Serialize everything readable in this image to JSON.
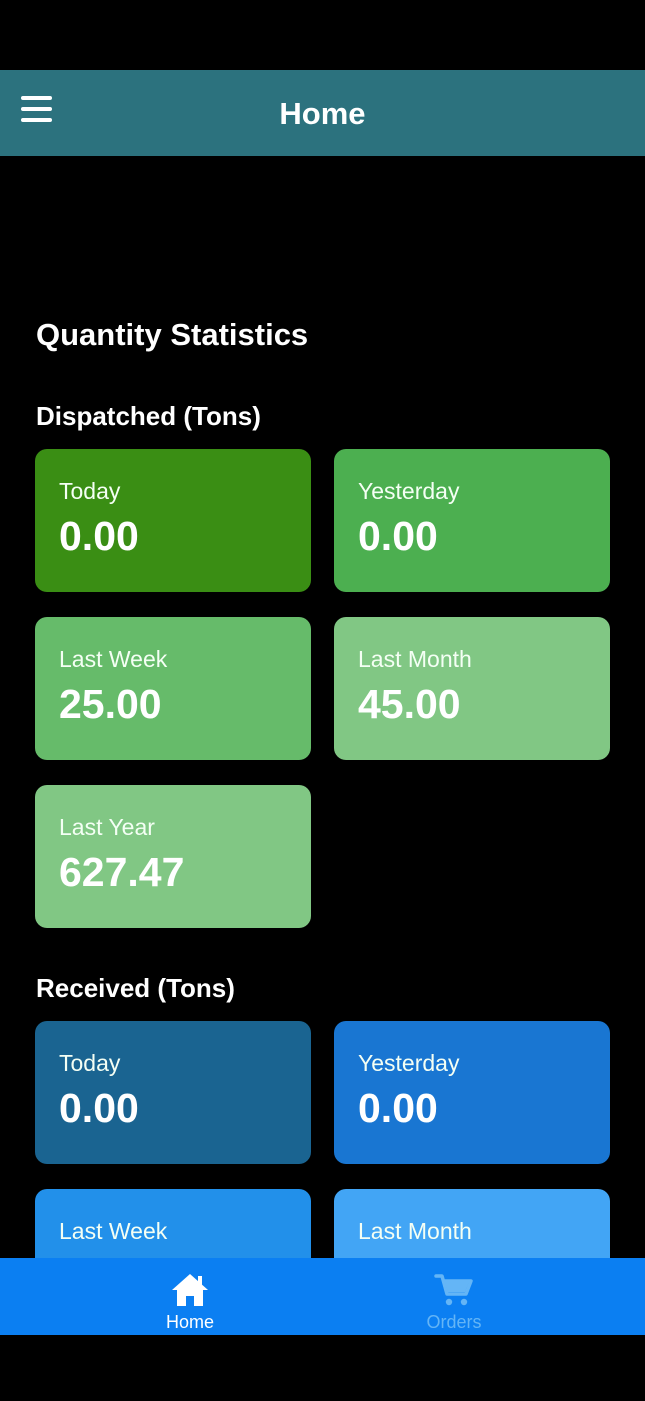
{
  "header": {
    "title": "Home"
  },
  "stats": {
    "title": "Quantity Statistics",
    "dispatched": {
      "heading": "Dispatched (Tons)",
      "cards": [
        {
          "label": "Today",
          "value": "0.00",
          "color": "#3a8e14"
        },
        {
          "label": "Yesterday",
          "value": "0.00",
          "color": "#4caf50"
        },
        {
          "label": "Last Week",
          "value": "25.00",
          "color": "#66bb6a"
        },
        {
          "label": "Last Month",
          "value": "45.00",
          "color": "#81c784"
        },
        {
          "label": "Last Year",
          "value": "627.47",
          "color": "#81c784"
        }
      ]
    },
    "received": {
      "heading": "Received (Tons)",
      "cards": [
        {
          "label": "Today",
          "value": "0.00",
          "color": "#1a6491"
        },
        {
          "label": "Yesterday",
          "value": "0.00",
          "color": "#1976d2"
        },
        {
          "label": "Last Week",
          "value": "",
          "color": "#2290ea"
        },
        {
          "label": "Last Month",
          "value": "",
          "color": "#42a5f5"
        }
      ]
    }
  },
  "bottom_nav": {
    "home": {
      "label": "Home",
      "icon": "home-icon",
      "color": "#ffffff"
    },
    "orders": {
      "label": "Orders",
      "icon": "cart-icon",
      "color": "#64b5f6"
    }
  },
  "colors": {
    "app_bar": "#2c727e",
    "bottom_nav": "#0b7ff2",
    "background": "#000000"
  }
}
